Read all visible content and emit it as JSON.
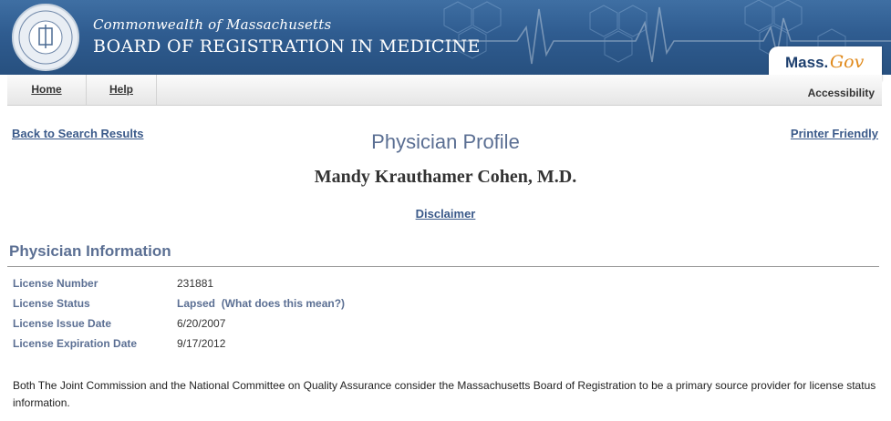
{
  "header": {
    "agency_line1": "Commonwealth of Massachusetts",
    "agency_line2": "BOARD OF REGISTRATION IN MEDICINE",
    "massgov_part1": "Mass.",
    "massgov_part2": "Gov",
    "seal_text": "BOARD OF REGISTRATION IN MEDICINE"
  },
  "nav": {
    "items": [
      {
        "label": "Home"
      },
      {
        "label": "Help"
      }
    ],
    "accessibility": "Accessibility"
  },
  "page": {
    "back_link": "Back to Search Results",
    "printer_link": "Printer Friendly",
    "title": "Physician Profile",
    "physician_name": "Mandy Krauthamer Cohen, M.D.",
    "disclaimer": "Disclaimer"
  },
  "physician_info": {
    "heading": "Physician Information",
    "rows": [
      {
        "label": "License Number",
        "value": "231881"
      },
      {
        "label": "License Status",
        "value": "Lapsed",
        "help": "(What does this mean?)"
      },
      {
        "label": "License Issue Date",
        "value": "6/20/2007"
      },
      {
        "label": "License Expiration Date",
        "value": "9/17/2012"
      }
    ]
  },
  "footnote": "Both The Joint Commission and the National Committee on Quality Assurance consider the Massachusetts Board of Registration to be a primary source provider for license status information.",
  "colors": {
    "banner": "#2f5c90",
    "heading_blue": "#5b6f93",
    "link_blue": "#3b5a8a",
    "massgov_orange": "#e08a1c"
  }
}
